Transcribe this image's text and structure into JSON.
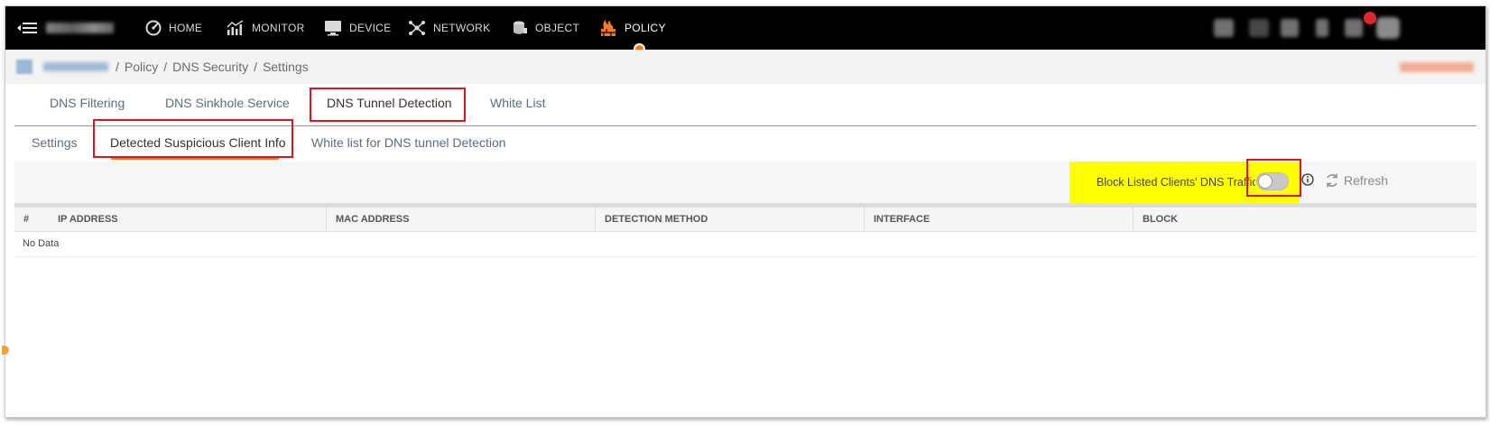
{
  "nav": {
    "items": [
      {
        "label": "HOME",
        "icon": "gauge-icon"
      },
      {
        "label": "MONITOR",
        "icon": "monitor-chart-icon"
      },
      {
        "label": "DEVICE",
        "icon": "device-screen-icon"
      },
      {
        "label": "NETWORK",
        "icon": "network-nodes-icon"
      },
      {
        "label": "OBJECT",
        "icon": "object-cylinder-icon"
      },
      {
        "label": "POLICY",
        "icon": "policy-firewall-icon"
      }
    ],
    "active": "POLICY",
    "accent_color": "#f47a20",
    "notification_color": "#e0262d"
  },
  "breadcrumb": {
    "items": [
      "Policy",
      "DNS Security",
      "Settings"
    ],
    "separator": "/"
  },
  "tabs": {
    "primary": [
      "DNS Filtering",
      "DNS Sinkhole Service",
      "DNS Tunnel Detection",
      "White List"
    ],
    "primary_active": "DNS Tunnel Detection",
    "secondary": [
      "Settings",
      "Detected Suspicious Client Info",
      "White list for DNS tunnel Detection"
    ],
    "secondary_active": "Detected Suspicious Client Info"
  },
  "toolbar": {
    "block_label": "Block Listed Clients' DNS Traffic",
    "toggle_on": false,
    "refresh_label": "Refresh",
    "highlight_color": "#ffff00"
  },
  "table": {
    "columns": [
      "#",
      "IP ADDRESS",
      "MAC ADDRESS",
      "DETECTION METHOD",
      "INTERFACE",
      "BLOCK"
    ],
    "empty_text": "No Data"
  },
  "annotation_color": "#e0131b"
}
